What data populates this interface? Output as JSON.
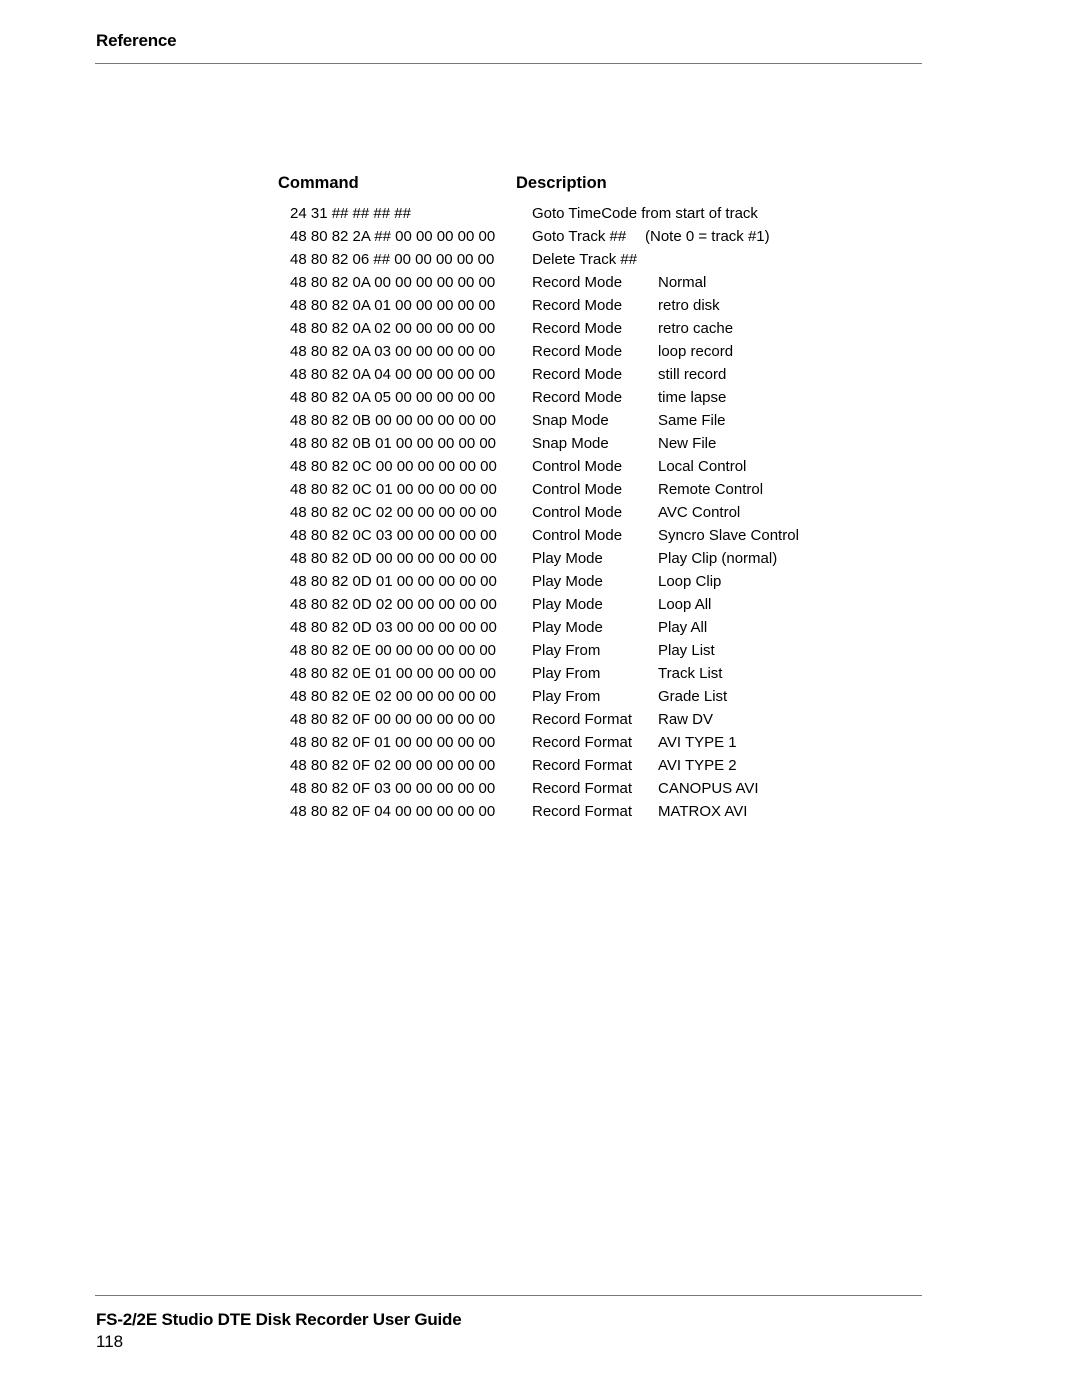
{
  "header": {
    "section_title": "Reference"
  },
  "table": {
    "columns": {
      "command": "Command",
      "description": "Description"
    },
    "rows": [
      {
        "command": "24 31 ## ## ## ##",
        "mode": "Goto TimeCode from start of track",
        "value": "",
        "note": ""
      },
      {
        "command": "48 80 82 2A ## 00 00 00 00 00",
        "mode": "Goto Track ##",
        "value": "",
        "note": "(Note 0 = track #1)"
      },
      {
        "command": "48 80 82 06 ## 00 00 00 00 00",
        "mode": "Delete Track ##",
        "value": "",
        "note": ""
      },
      {
        "command": "48 80 82 0A 00 00 00 00 00 00",
        "mode": "Record Mode",
        "value": "Normal",
        "note": ""
      },
      {
        "command": "48 80 82 0A 01 00 00 00 00 00",
        "mode": "Record Mode",
        "value": "retro disk",
        "note": ""
      },
      {
        "command": "48 80 82 0A 02 00 00 00 00 00",
        "mode": "Record Mode",
        "value": "retro cache",
        "note": ""
      },
      {
        "command": "48 80 82 0A 03 00 00 00 00 00",
        "mode": "Record Mode",
        "value": "loop record",
        "note": ""
      },
      {
        "command": "48 80 82 0A 04 00 00 00 00 00",
        "mode": "Record Mode",
        "value": "still record",
        "note": ""
      },
      {
        "command": "48 80 82 0A 05 00 00 00 00 00",
        "mode": "Record Mode",
        "value": "time lapse",
        "note": ""
      },
      {
        "command": "48 80 82 0B 00 00 00 00 00 00",
        "mode": "Snap Mode",
        "value": "Same File",
        "note": ""
      },
      {
        "command": "48 80 82 0B 01 00 00 00 00 00",
        "mode": "Snap Mode",
        "value": "New File",
        "note": ""
      },
      {
        "command": "48 80 82 0C 00 00 00 00 00 00",
        "mode": "Control Mode",
        "value": "Local Control",
        "note": ""
      },
      {
        "command": "48 80 82 0C 01 00 00 00 00 00",
        "mode": "Control Mode",
        "value": "Remote Control",
        "note": ""
      },
      {
        "command": "48 80 82 0C 02 00 00 00 00 00",
        "mode": "Control Mode",
        "value": "AVC Control",
        "note": ""
      },
      {
        "command": "48 80 82 0C 03 00 00 00 00 00",
        "mode": "Control Mode",
        "value": "Syncro Slave Control",
        "note": ""
      },
      {
        "command": "48 80 82 0D 00 00 00 00 00 00",
        "mode": "Play Mode",
        "value": "Play Clip (normal)",
        "note": ""
      },
      {
        "command": "48 80 82 0D 01 00 00 00 00 00",
        "mode": "Play Mode",
        "value": "Loop Clip",
        "note": ""
      },
      {
        "command": "48 80 82 0D 02 00 00 00 00 00",
        "mode": "Play Mode",
        "value": "Loop All",
        "note": ""
      },
      {
        "command": "48 80 82 0D 03 00 00 00 00 00",
        "mode": "Play Mode",
        "value": "Play All",
        "note": ""
      },
      {
        "command": "48 80 82 0E 00 00 00 00 00 00",
        "mode": "Play From",
        "value": "Play List",
        "note": ""
      },
      {
        "command": "48 80 82 0E 01 00 00 00 00 00",
        "mode": "Play From",
        "value": "Track List",
        "note": ""
      },
      {
        "command": "48 80 82 0E 02 00 00 00 00 00",
        "mode": "Play From",
        "value": "Grade List",
        "note": ""
      },
      {
        "command": "48 80 82 0F 00 00 00 00 00 00",
        "mode": "Record Format",
        "value": "Raw DV",
        "note": ""
      },
      {
        "command": "48 80 82 0F 01 00 00 00 00 00",
        "mode": "Record Format",
        "value": "AVI TYPE 1",
        "note": ""
      },
      {
        "command": "48 80 82 0F 02 00 00 00 00 00",
        "mode": "Record Format",
        "value": "AVI TYPE 2",
        "note": ""
      },
      {
        "command": "48 80 82 0F 03 00 00 00 00 00",
        "mode": "Record Format",
        "value": "CANOPUS AVI",
        "note": ""
      },
      {
        "command": "48 80 82 0F 04 00 00 00 00 00",
        "mode": "Record Format",
        "value": "MATROX AVI",
        "note": ""
      }
    ]
  },
  "footer": {
    "guide_title": "FS-2/2E Studio DTE Disk Recorder User Guide",
    "page_number": "118"
  }
}
